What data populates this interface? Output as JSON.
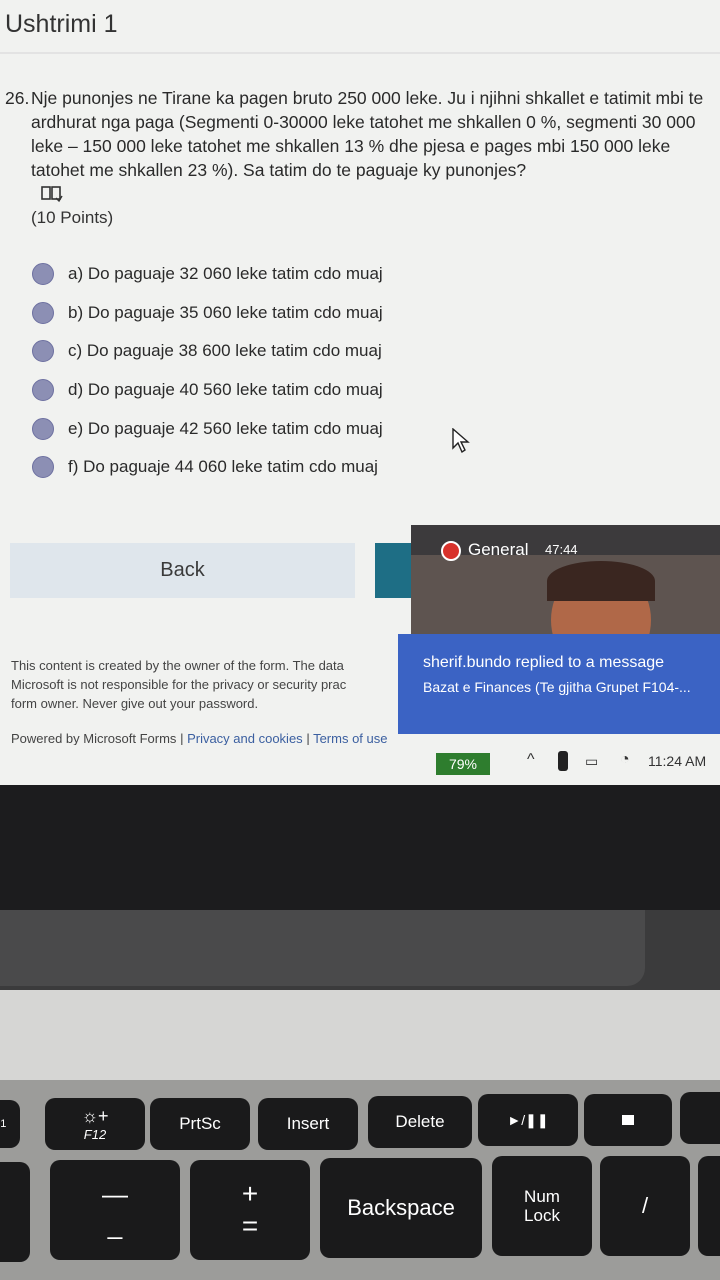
{
  "form": {
    "title": "Ushtrimi 1",
    "question_number": "26.",
    "question_text": "Nje punonjes ne Tirane ka pagen bruto 250 000 leke. Ju i njihni shkallet e tatimit mbi te ardhurat nga paga (Segmenti 0-30000 leke tatohet me shkallen 0 %, segmenti 30 000 leke – 150 000 leke tatohet me shkallen 13 % dhe pjesa e pages mbi 150 000 leke tatohet me shkallen 23 %). Sa tatim do te paguaje ky punonjes?",
    "points": "(10 Points)",
    "options": [
      {
        "label": "a) Do paguaje 32 060 leke tatim cdo muaj"
      },
      {
        "label": "b) Do paguaje 35 060 leke tatim cdo muaj"
      },
      {
        "label": "c) Do paguaje 38 600 leke tatim cdo muaj"
      },
      {
        "label": "d) Do paguaje 40 560 leke tatim cdo muaj"
      },
      {
        "label": "e) Do paguaje 42 560 leke tatim cdo muaj"
      },
      {
        "label": "f) Do paguaje 44 060 leke tatim cdo muaj"
      }
    ],
    "back_label": "Back",
    "footer_line1": "This content is created by the owner of the form. The data",
    "footer_line2": "Microsoft is not responsible for the privacy or security prac",
    "footer_line3": "form owner. Never give out your password.",
    "powered_by": "Powered by Microsoft Forms",
    "privacy_link": "Privacy and cookies",
    "terms_link": "Terms of use"
  },
  "call": {
    "channel": "General",
    "duration": "47:44"
  },
  "toast": {
    "title": "sherif.bundo replied to a message",
    "body": "Bazat e Finances (Te gjitha Grupet F104-..."
  },
  "taskbar": {
    "battery": "79%",
    "clock": "11:24 AM"
  },
  "keyboard": {
    "f12_symbol": "☼+",
    "f12_label": "F12",
    "prtsc": "PrtSc",
    "insert": "Insert",
    "delete": "Delete",
    "play_pause": "►/❚❚",
    "minus_top": "—",
    "minus_bottom": "_",
    "plus_top": "+",
    "plus_bottom": "=",
    "backspace": "Backspace",
    "num_lock": "Num Lock",
    "slash": "/"
  }
}
